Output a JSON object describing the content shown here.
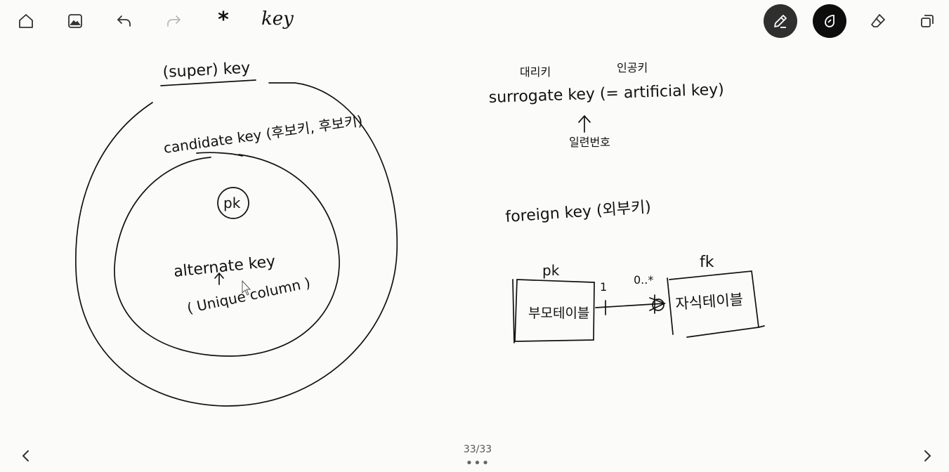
{
  "toolbar": {
    "title": "key",
    "star": "*",
    "page_indicator": "33/33",
    "dots": "•••"
  },
  "diagram": {
    "super_key": "(super) key",
    "candidate_key": "candidate key (후보키, 후보키)",
    "pk_circle": "pk",
    "alternate_key": "alternate key",
    "unique_column": "( Unique column )",
    "surrogate_key": "surrogate key (= artificial key)",
    "surrogate_kr_left": "대리키",
    "surrogate_kr_right": "인공키",
    "serial_number": "일련번호",
    "foreign_key": "foreign key (외부키)",
    "pk_label": "pk",
    "fk_label": "fk",
    "one_label": "1",
    "many_label": "0..*",
    "parent_table": "부모테이블",
    "child_table": "자식테이블"
  },
  "colors": {
    "ink": "#111111",
    "background": "#fbfbfa",
    "active_tool": "#2f2f2f"
  }
}
